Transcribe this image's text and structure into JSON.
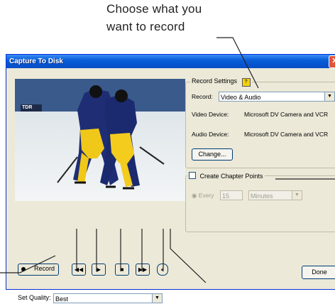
{
  "callout": {
    "line1": "Choose what you",
    "line2": "want to record"
  },
  "window": {
    "title": "Capture To Disk"
  },
  "video": {
    "banner": "TDR"
  },
  "controls": {
    "record_label": "Record"
  },
  "quality": {
    "label": "Set Quality:",
    "value": "Best"
  },
  "record_settings": {
    "legend": "Record Settings",
    "help": "?",
    "record_label": "Record:",
    "record_value": "Video & Audio",
    "video_device_label": "Video Device:",
    "video_device_value": "Microsoft DV Camera and VCR",
    "audio_device_label": "Audio Device:",
    "audio_device_value": "Microsoft DV Camera and VCR",
    "change_button": "Change..."
  },
  "chapter": {
    "label": "Create Chapter Points",
    "every_label": "Every",
    "every_value": "15",
    "unit_value": "Minutes"
  },
  "footer": {
    "done_button": "Done"
  }
}
